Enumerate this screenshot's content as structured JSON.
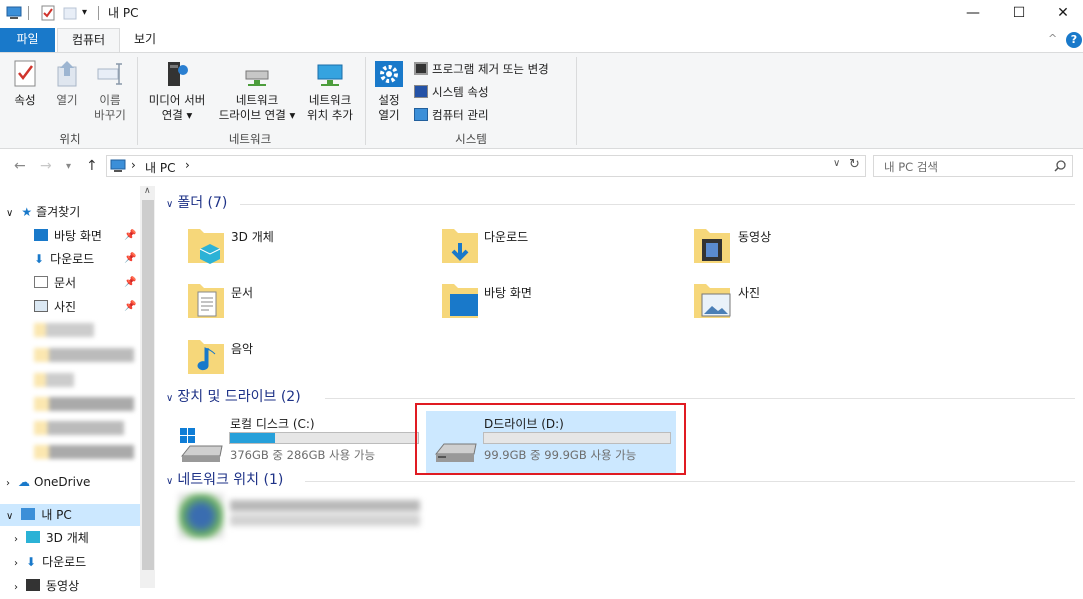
{
  "window": {
    "title": "내 PC",
    "minimize": "—",
    "maximize": "☐",
    "close": "✕"
  },
  "ribbon_tabs": {
    "file": "파일",
    "computer": "컴퓨터",
    "view": "보기"
  },
  "ribbon": {
    "location_group": "위치",
    "properties": "속성",
    "open": "열기",
    "rename_line1": "이름",
    "rename_line2": "바꾸기",
    "network_group": "네트워크",
    "access_media_line1": "미디어 서버",
    "access_media_line2": "연결 ▾",
    "map_drive_line1": "네트워크",
    "map_drive_line2": "드라이브 연결 ▾",
    "add_location_line1": "네트워크",
    "add_location_line2": "위치 추가",
    "system_group": "시스템",
    "open_settings_line1": "설정",
    "open_settings_line2": "열기",
    "uninstall": "프로그램 제거 또는 변경",
    "system_properties": "시스템 속성",
    "manage": "컴퓨터 관리",
    "help": "?",
    "collapse": "^"
  },
  "address": {
    "breadcrumb_pc": "내 PC",
    "separator": "›",
    "search_placeholder": "내 PC 검색"
  },
  "nav": {
    "quick_access": "즐겨찾기",
    "desktop": "바탕 화면",
    "downloads": "다운로드",
    "documents": "문서",
    "pictures": "사진",
    "onedrive": "OneDrive",
    "this_pc": "내 PC",
    "objects3d": "3D 개체",
    "downloads2": "다운로드",
    "videos": "동영상"
  },
  "sections": {
    "folders": "폴더 (7)",
    "drives": "장치 및 드라이브 (2)",
    "network": "네트워크 위치 (1)"
  },
  "folders": [
    {
      "label": "3D 개체"
    },
    {
      "label": "다운로드"
    },
    {
      "label": "동영상"
    },
    {
      "label": "문서"
    },
    {
      "label": "바탕 화면"
    },
    {
      "label": "사진"
    },
    {
      "label": "음악"
    }
  ],
  "drives": [
    {
      "label": "로컬 디스크 (C:)",
      "free": "376GB 중 286GB 사용 가능",
      "used_fraction": 0.24
    },
    {
      "label": "D드라이브 (D:)",
      "free": "99.9GB 중 99.9GB 사용 가능",
      "used_fraction": 0.0
    }
  ],
  "colors": {
    "accent": "#1979ca",
    "section_header": "#1e3287",
    "highlight": "#e01b22",
    "selection": "#cce8ff",
    "drive_fill": "#26a0da"
  }
}
